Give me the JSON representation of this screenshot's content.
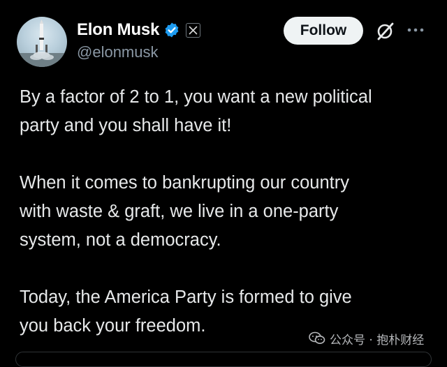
{
  "author": {
    "display_name": "Elon Musk",
    "handle": "@elonmusk",
    "verified_icon": "verified-badge-icon",
    "affiliate_icon": "x-logo-icon"
  },
  "actions": {
    "follow_label": "Follow",
    "grok_icon": "grok-icon",
    "more_icon": "more-options-icon"
  },
  "tweet": {
    "lines": [
      "By a factor of 2 to 1, you want a new political",
      "party and you shall have it!",
      "When it comes to bankrupting our country",
      "with waste & graft, we live in a one-party",
      "system, not a democracy.",
      "Today, the America Party is formed to give",
      "you back your freedom."
    ]
  },
  "watermark": {
    "text": "公众号 · 抱朴财经"
  },
  "colors": {
    "background": "#000000",
    "text": "#e7e9ea",
    "secondary_text": "#8b98a5",
    "verified_blue": "#1d9bf0",
    "follow_bg": "#eff3f4"
  }
}
